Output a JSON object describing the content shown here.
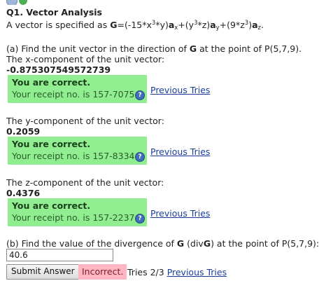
{
  "title": "Q1. Vector Analysis",
  "intro_prefix": "A vector is specified as ",
  "vector": {
    "G": "G",
    "eq": "=(-15*x",
    "p3a": "3",
    "py": "*y)",
    "ax": "a",
    "x": "x",
    "plus1": "+(y",
    "p3b": "3",
    "pz": "*z)",
    "ay": "a",
    "y": "y",
    "plus2": "+(9*z",
    "p3c": "3",
    "close": ")",
    "az": "a",
    "z": "z",
    "dot": "."
  },
  "part_a_prompt_1": "(a) Find the unit vector in the direction of ",
  "part_a_G": "G",
  "part_a_prompt_2": " at the point of P(5,7,9).",
  "x_label": "The x-component of the unit vector:",
  "x_value": "-0.875307549572739",
  "y_label": "The y-component of the unit vector:",
  "y_value": "0.2059",
  "z_label": "The z-component of the unit vector:",
  "z_value": "0.4376",
  "correct": [
    {
      "msg": "You are correct.",
      "receipt": "Your receipt no. is 157-7075"
    },
    {
      "msg": "You are correct.",
      "receipt": "Your receipt no. is 157-8334"
    },
    {
      "msg": "You are correct.",
      "receipt": "Your receipt no. is 157-2237"
    }
  ],
  "previous_tries": "Previous Tries",
  "help_glyph": "?",
  "part_b_prompt_1": "(b) Find the value of the divergence of ",
  "part_b_G": "G",
  "part_b_div_open": " (div",
  "part_b_divG": "G",
  "part_b_prompt_2": ") at the point of P(5,7,9):",
  "answer_value": "40.6",
  "submit_label": "Submit Answer",
  "incorrect_label": "Incorrect.",
  "tries_text": "Tries 2/3 ",
  "status_colors": {
    "correct_bg": "#90ee90",
    "incorrect_bg": "#ffb6c1",
    "link": "#1a3d99"
  }
}
